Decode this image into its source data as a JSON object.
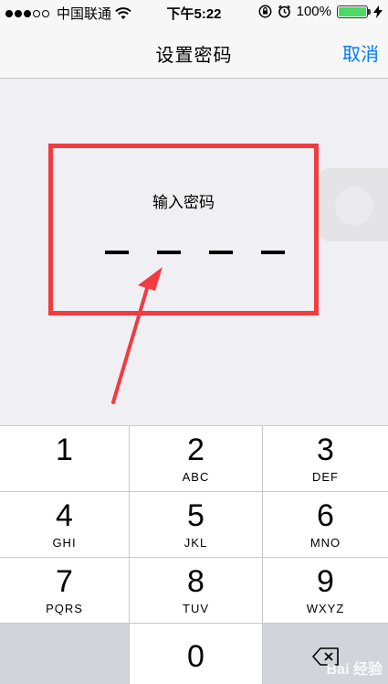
{
  "status_bar": {
    "signal_dots_filled": 3,
    "signal_dots_total": 5,
    "carrier": "中国联通",
    "time": "下午5:22",
    "battery_percent_label": "100%",
    "battery_level": 1.0
  },
  "nav": {
    "title": "设置密码",
    "cancel_label": "取消"
  },
  "passcode": {
    "prompt": "输入密码",
    "digits_total": 4,
    "digits_entered": 0
  },
  "keypad": {
    "keys": [
      {
        "digit": "1",
        "letters": ""
      },
      {
        "digit": "2",
        "letters": "ABC"
      },
      {
        "digit": "3",
        "letters": "DEF"
      },
      {
        "digit": "4",
        "letters": "GHI"
      },
      {
        "digit": "5",
        "letters": "JKL"
      },
      {
        "digit": "6",
        "letters": "MNO"
      },
      {
        "digit": "7",
        "letters": "PQRS"
      },
      {
        "digit": "8",
        "letters": "TUV"
      },
      {
        "digit": "9",
        "letters": "WXYZ"
      },
      {
        "digit": "0",
        "letters": ""
      }
    ]
  },
  "annotation": {
    "highlight_color": "#f23b3f"
  },
  "watermark": {
    "text": "Bai 经验"
  },
  "colors": {
    "accent": "#007aff",
    "battery": "#4cd964",
    "keypad_dark": "#d1d5db"
  }
}
